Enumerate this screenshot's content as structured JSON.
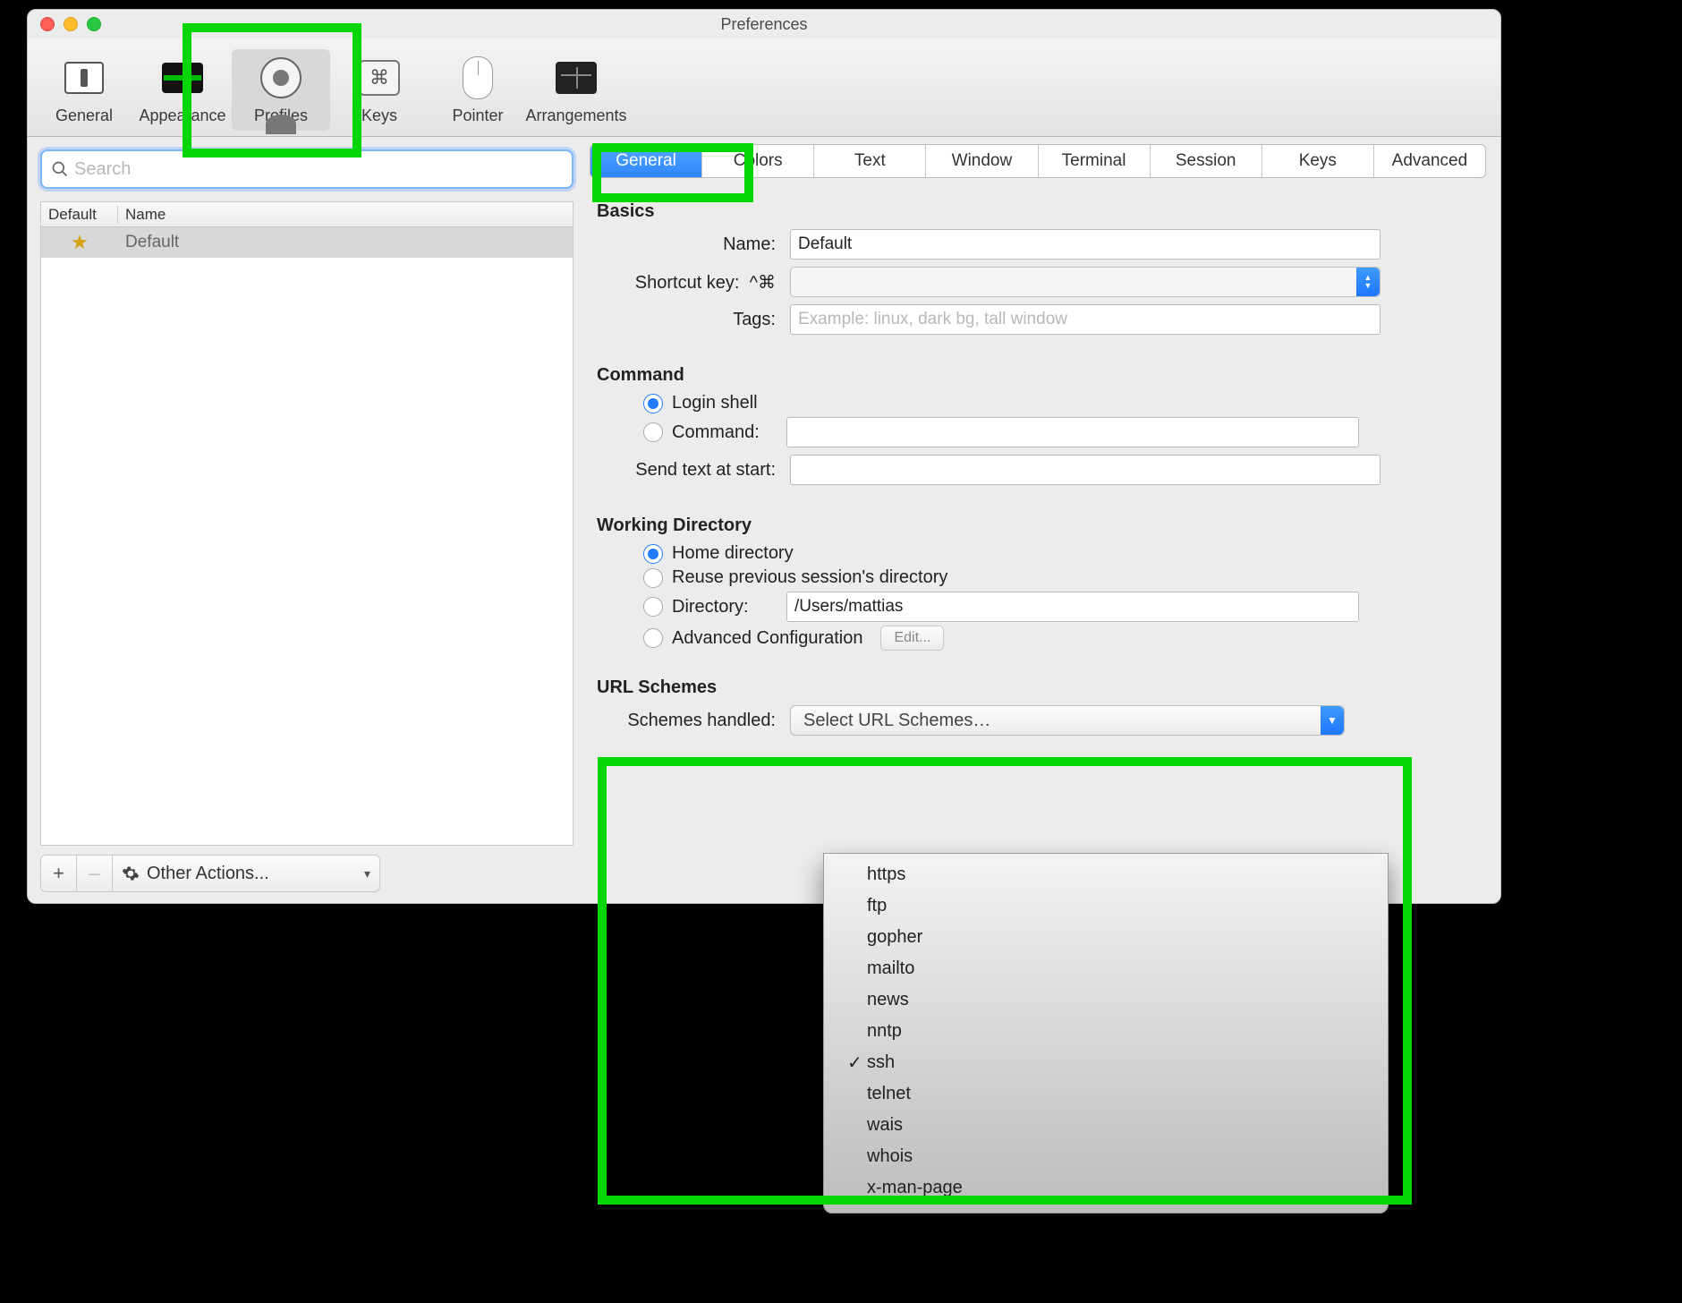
{
  "window": {
    "title": "Preferences"
  },
  "toolbar": {
    "items": [
      {
        "label": "General"
      },
      {
        "label": "Appearance"
      },
      {
        "label": "Profiles"
      },
      {
        "label": "Keys"
      },
      {
        "label": "Pointer"
      },
      {
        "label": "Arrangements"
      }
    ]
  },
  "sidebar": {
    "search_placeholder": "Search",
    "columns": {
      "c1": "Default",
      "c2": "Name"
    },
    "rows": [
      {
        "name": "Default",
        "starred": true,
        "selected": true
      }
    ],
    "footer": {
      "add": "+",
      "remove": "–",
      "actions_label": "Other Actions..."
    }
  },
  "tabs": [
    "General",
    "Colors",
    "Text",
    "Window",
    "Terminal",
    "Session",
    "Keys",
    "Advanced"
  ],
  "sections": {
    "basics": {
      "heading": "Basics",
      "name_label": "Name:",
      "name_value": "Default",
      "shortcut_label": "Shortcut key:",
      "shortcut_prefix": "^⌘",
      "tags_label": "Tags:",
      "tags_placeholder": "Example: linux, dark bg, tall window"
    },
    "command": {
      "heading": "Command",
      "login_shell": "Login shell",
      "command": "Command:",
      "send_text_label": "Send text at start:"
    },
    "working_dir": {
      "heading": "Working Directory",
      "home": "Home directory",
      "reuse": "Reuse previous session's directory",
      "directory": "Directory:",
      "directory_value": "/Users/mattias",
      "advanced": "Advanced Configuration",
      "edit": "Edit..."
    },
    "url": {
      "heading": "URL Schemes",
      "label": "Schemes handled:",
      "select_text": "Select URL Schemes…",
      "options": [
        "https",
        "ftp",
        "gopher",
        "mailto",
        "news",
        "nntp",
        "ssh",
        "telnet",
        "wais",
        "whois",
        "x-man-page"
      ],
      "checked": "ssh"
    }
  }
}
